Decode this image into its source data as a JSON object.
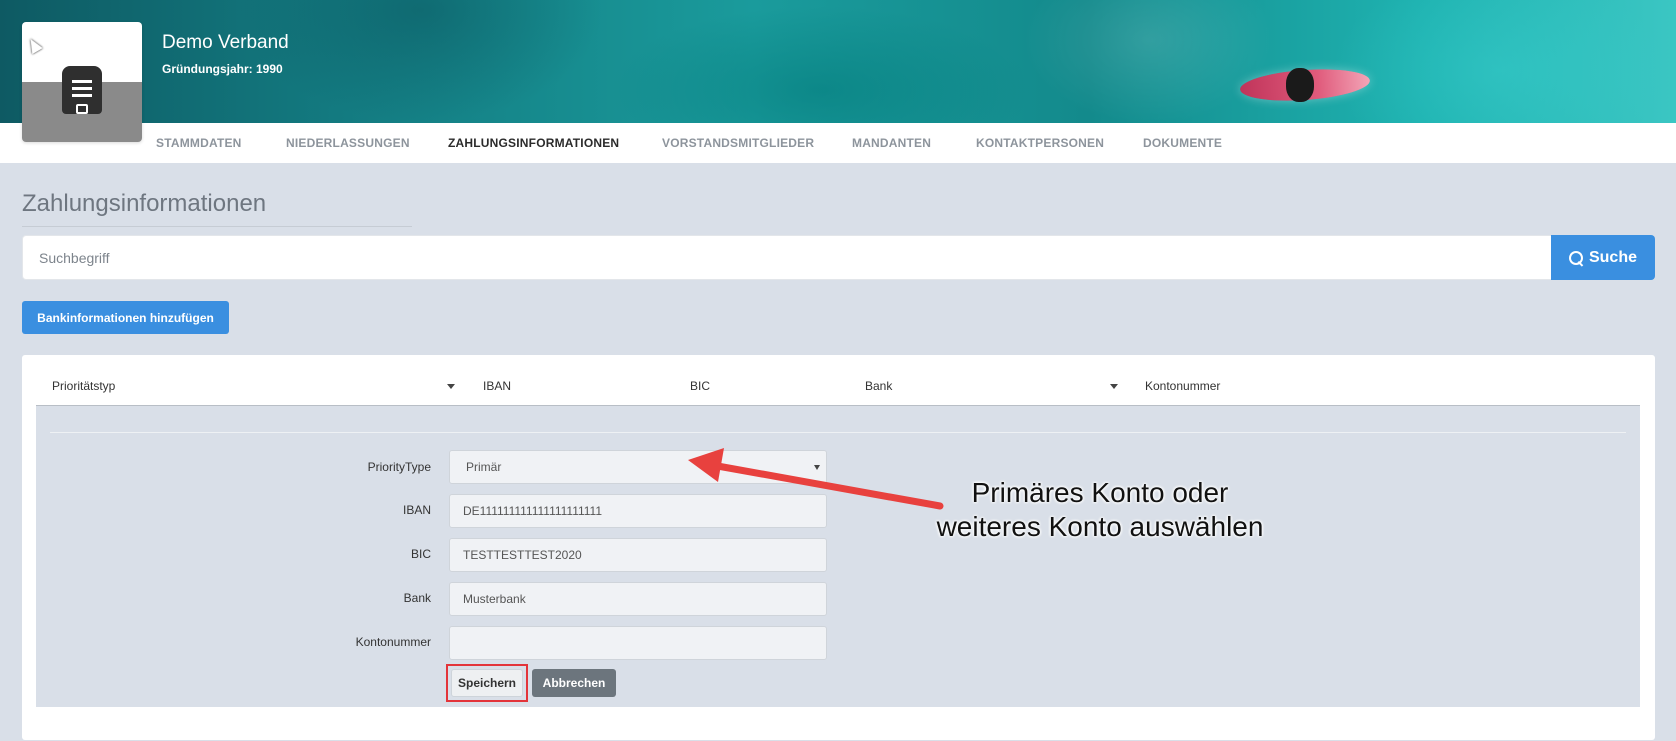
{
  "org": {
    "name": "Demo Verband",
    "founding_year": "Gründungsjahr: 1990"
  },
  "nav": {
    "items": [
      {
        "label": "STAMMDATEN",
        "active": false
      },
      {
        "label": "NIEDERLASSUNGEN",
        "active": false
      },
      {
        "label": "ZAHLUNGSINFORMATIONEN",
        "active": true
      },
      {
        "label": "VORSTANDSMITGLIEDER",
        "active": false
      },
      {
        "label": "MANDANTEN",
        "active": false
      },
      {
        "label": "KONTAKTPERSONEN",
        "active": false
      },
      {
        "label": "DOKUMENTE",
        "active": false
      }
    ]
  },
  "page": {
    "title": "Zahlungsinformationen"
  },
  "search": {
    "placeholder": "Suchbegriff",
    "button_label": "Suche"
  },
  "actions": {
    "add_bank_label": "Bankinformationen hinzufügen"
  },
  "table": {
    "columns": [
      "Prioritätstyp",
      "IBAN",
      "BIC",
      "Bank",
      "Kontonummer"
    ]
  },
  "form": {
    "priority": {
      "label": "PriorityType",
      "value": "Primär"
    },
    "iban": {
      "label": "IBAN",
      "value": "DE111111111111111111111"
    },
    "bic": {
      "label": "BIC",
      "value": "TESTTESTTEST2020"
    },
    "bank": {
      "label": "Bank",
      "value": "Musterbank"
    },
    "account": {
      "label": "Kontonummer",
      "value": ""
    },
    "save_label": "Speichern",
    "cancel_label": "Abbrechen"
  },
  "annotation": {
    "line1": "Primäres Konto oder",
    "line2": "weiteres Konto auswählen",
    "color": "#e8413e"
  },
  "colors": {
    "accent": "#3a8fe0",
    "cancel": "#6c757d",
    "highlight": "#e3343a"
  },
  "icons": {
    "logo": "document-icon",
    "search": "search-icon",
    "cursor": "cursor-icon"
  }
}
